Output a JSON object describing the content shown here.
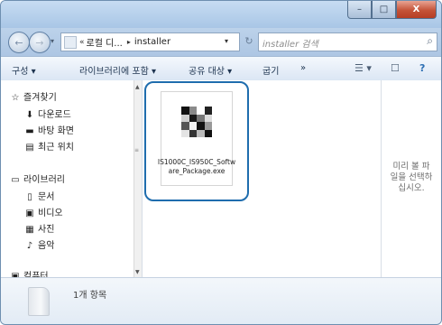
{
  "window": {
    "caption_buttons": {
      "minimize": "–",
      "maximize": "□",
      "close": "X"
    }
  },
  "nav": {
    "back_icon": "←",
    "forward_icon": "→",
    "dropdown_icon": "▾"
  },
  "address_bar": {
    "chevrons": "«",
    "segments": [
      "로컬 디...",
      "installer"
    ],
    "separator": "▸",
    "dropdown": "▾",
    "refresh_icon": "↻"
  },
  "search": {
    "placeholder": "installer 검색",
    "icon": "⌕"
  },
  "toolbar": {
    "organize": "구성 ▾",
    "include_library": "라이브러리에 포함 ▾",
    "share_with": "공유 대상 ▾",
    "burn": "굽기",
    "more": "»",
    "views_icon": "☰ ▾",
    "preview_pane_icon": "☐",
    "help_icon": "?"
  },
  "sidebar": {
    "items": [
      {
        "label": "즐겨찾기",
        "icon": "☆"
      },
      {
        "label": "다운로드",
        "icon": "⬇"
      },
      {
        "label": "바탕 화면",
        "icon": "▬"
      },
      {
        "label": "최근 위치",
        "icon": "▤"
      },
      {
        "label": "라이브러리",
        "icon": "▭"
      },
      {
        "label": "문서",
        "icon": "▯"
      },
      {
        "label": "비디오",
        "icon": "▣"
      },
      {
        "label": "사진",
        "icon": "▦"
      },
      {
        "label": "음악",
        "icon": "♪"
      },
      {
        "label": "컴퓨터",
        "icon": "▣"
      }
    ]
  },
  "files": [
    {
      "name": "IS1000C_IS950C_Software_Package.exe",
      "name_line1": "IS1000C_IS950C_Softw",
      "name_line2": "are_Package.exe",
      "selected": true
    }
  ],
  "preview_pane": {
    "line1": "미리 볼 파",
    "line2": "일을 선택하",
    "line3": "십시오."
  },
  "details": {
    "count": "1개 항목"
  },
  "colors": {
    "selection_outline": "#1f6dae",
    "caption": "#a9c6e6",
    "close_button": "#c45338"
  }
}
